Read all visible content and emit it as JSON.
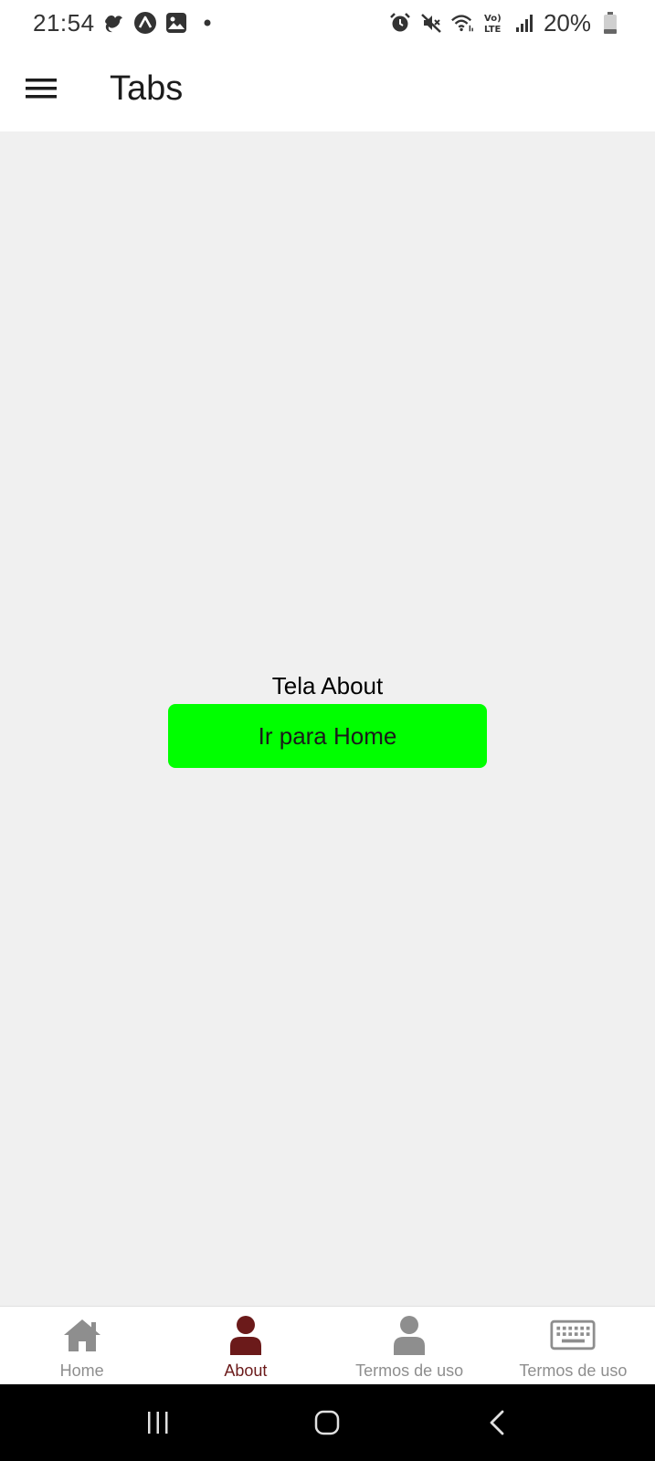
{
  "status_bar": {
    "time": "21:54",
    "battery": "20%",
    "icons": [
      "tinder-icon",
      "expo-icon",
      "gallery-icon",
      "dot-icon",
      "alarm-icon",
      "mute-icon",
      "wifi-icon",
      "volte-icon",
      "signal-icon",
      "battery-icon"
    ]
  },
  "header": {
    "title": "Tabs",
    "menu_icon": "hamburger-menu-icon"
  },
  "content": {
    "screen_label": "Tela About",
    "button_label": "Ir para Home",
    "button_color": "#00ff00"
  },
  "tabs": [
    {
      "label": "Home",
      "icon": "home-icon",
      "active": false
    },
    {
      "label": "About",
      "icon": "person-icon",
      "active": true
    },
    {
      "label": "Termos de uso",
      "icon": "person-icon",
      "active": false
    },
    {
      "label": "Termos de uso",
      "icon": "keyboard-icon",
      "active": false
    }
  ],
  "colors": {
    "active_tab": "#6b1a1a",
    "inactive_tab": "#8e8e8e",
    "background": "#f0f0f0"
  },
  "nav_bar": {
    "icons": [
      "recent-apps-icon",
      "home-nav-icon",
      "back-icon"
    ]
  }
}
